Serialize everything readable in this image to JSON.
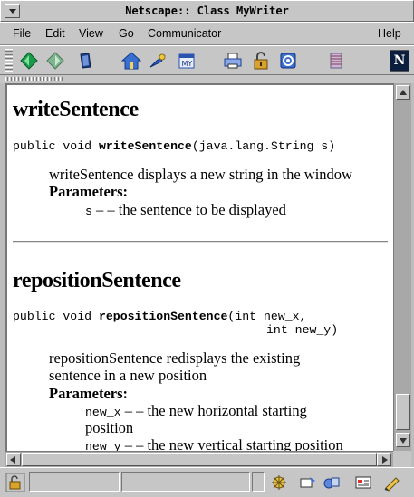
{
  "window": {
    "title": "Netscape:: Class MyWriter"
  },
  "menubar": {
    "items": [
      "File",
      "Edit",
      "View",
      "Go",
      "Communicator",
      "Help"
    ]
  },
  "toolbar": {
    "icons": [
      "back-icon",
      "forward-icon",
      "reload-icon",
      "home-icon",
      "search-icon",
      "my-netscape-icon",
      "print-icon",
      "security-icon",
      "shop-icon",
      "stop-icon"
    ],
    "logo": "N"
  },
  "content": {
    "method1": {
      "heading": "writeSentence",
      "signature_prefix": "public void ",
      "signature_name": "writeSentence",
      "signature_args": "(java.lang.String s)",
      "description": "writeSentence displays a new string in the window",
      "params_label": "Parameters:",
      "params": [
        {
          "name": "s",
          "desc": " – – the sentence to be displayed"
        }
      ]
    },
    "method2": {
      "heading": "repositionSentence",
      "signature_prefix": "public void ",
      "signature_name": "repositionSentence",
      "signature_args": "(int new_x,",
      "signature_args_line2": "int new_y)",
      "description_line1": "repositionSentence redisplays the existing",
      "description_line2": "sentence in a new position",
      "params_label": "Parameters:",
      "params": [
        {
          "name": "new_x",
          "desc": " – – the new horizontal starting",
          "desc_cont": "position"
        },
        {
          "name": "new_y",
          "desc": " – – the new vertical starting position"
        }
      ]
    }
  },
  "statusbar": {
    "message": "",
    "icons": [
      "component-bar-icon",
      "navigator-icon",
      "mail-icon",
      "discussions-icon",
      "composer-icon",
      "edit-icon"
    ]
  }
}
